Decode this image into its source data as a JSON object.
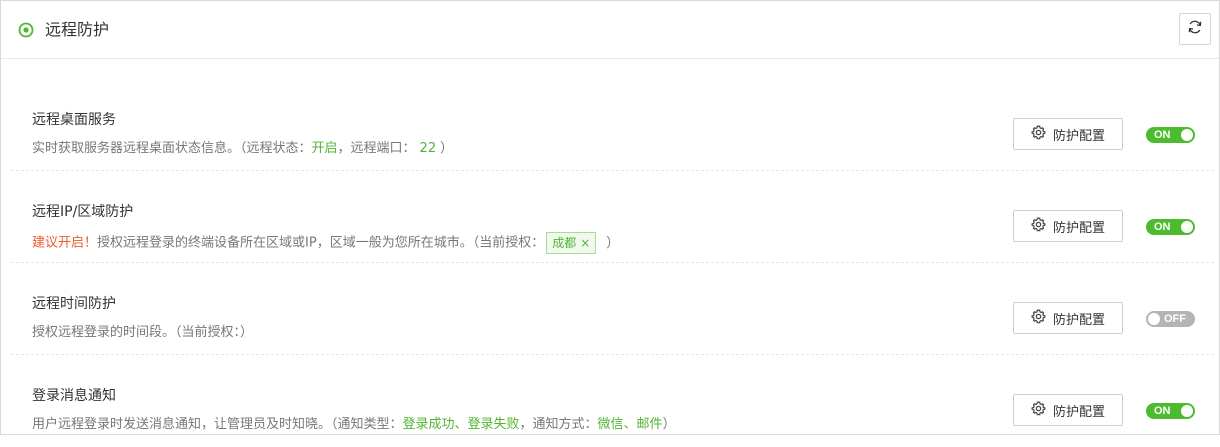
{
  "header": {
    "title": "远程防护",
    "icon": "target-icon",
    "refresh_icon": "refresh-icon",
    "accent": "#52b433"
  },
  "config_label": "防护配置",
  "rows": [
    {
      "title": "远程桌面服务",
      "desc_prefix": "实时获取服务器远程桌面状态信息。（远程状态：",
      "status_value": "开启",
      "desc_mid": "，远程端口：",
      "port_value": "22",
      "desc_suffix": "）",
      "toggle": "ON"
    },
    {
      "title": "远程IP/区域防护",
      "warning": "建议开启！",
      "desc_text": "授权远程登录的终端设备所在区域或IP，区域一般为您所在城市。（当前授权：",
      "tag": "成都",
      "tag_close": "×",
      "desc_suffix": "）",
      "toggle": "ON"
    },
    {
      "title": "远程时间防护",
      "desc_text": "授权远程登录的时间段。（当前授权：）",
      "toggle": "OFF"
    },
    {
      "title": "登录消息通知",
      "desc_prefix": "用户远程登录时发送消息通知，让管理员及时知晓。（通知类型：",
      "types_value": "登录成功、登录失败",
      "desc_mid": "，通知方式：",
      "methods_value": "微信、邮件",
      "desc_suffix": "）",
      "toggle": "ON"
    }
  ],
  "colors": {
    "toggle_on": "#4dbb2e",
    "toggle_off": "#b4b4b4",
    "warning": "#ef5a2f",
    "highlight": "#52b433"
  }
}
